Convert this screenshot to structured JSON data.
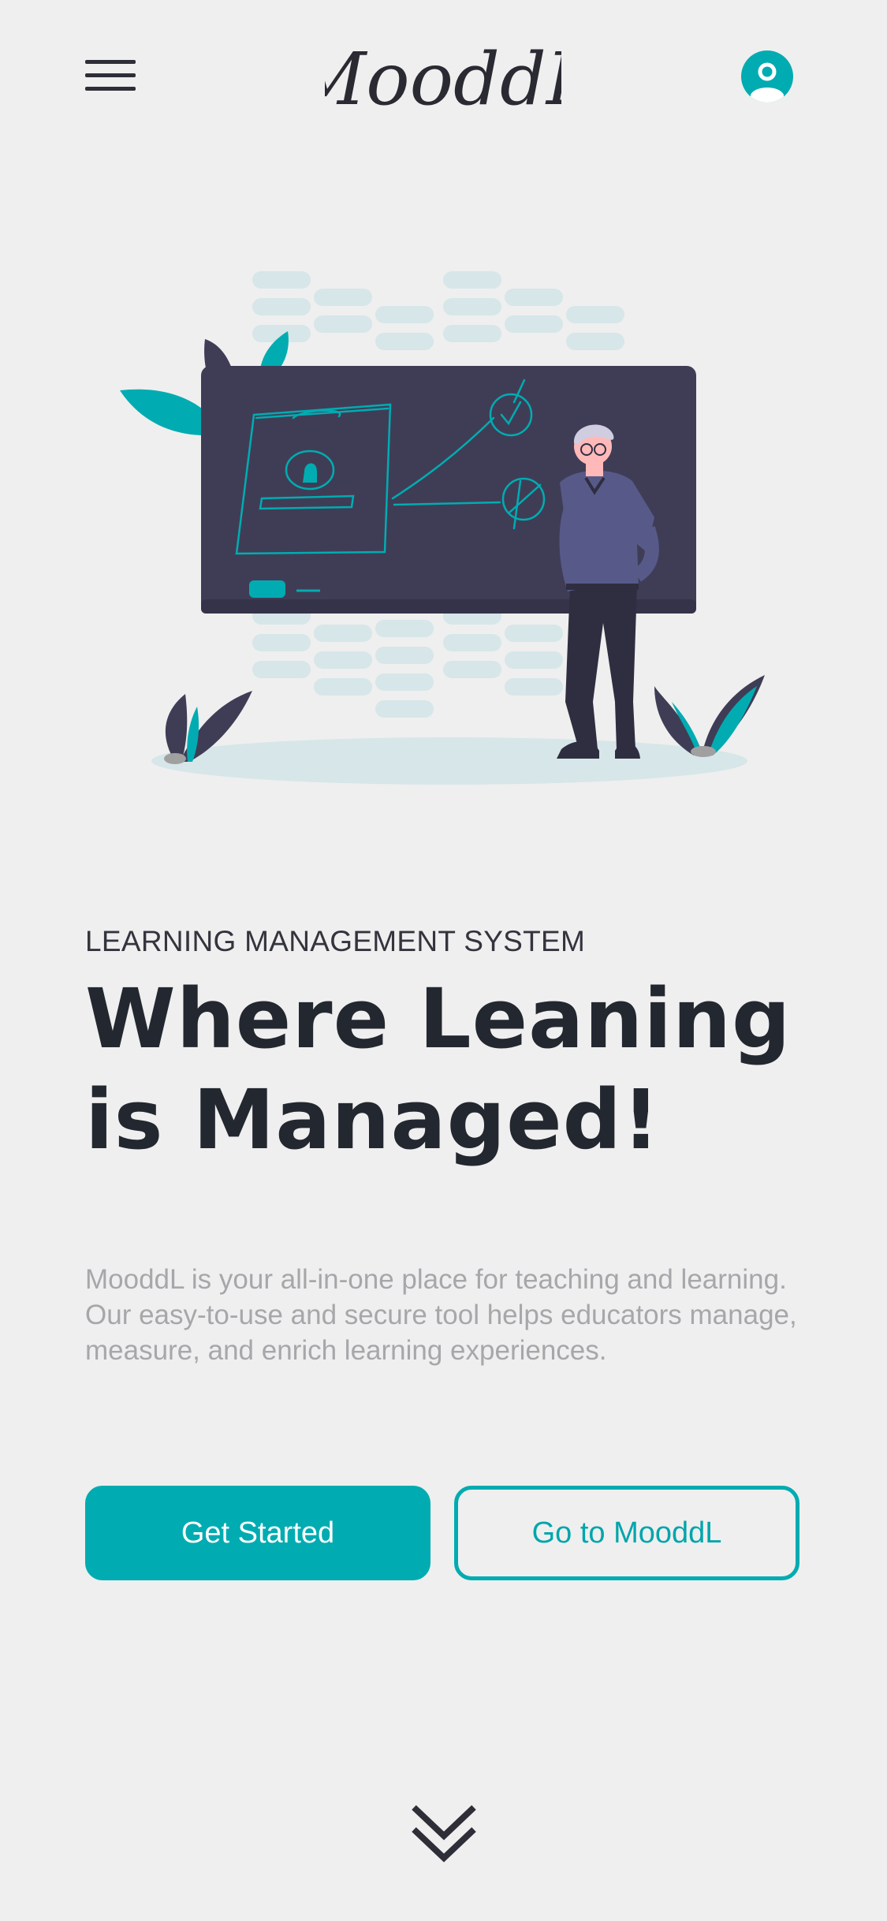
{
  "header": {
    "menu_icon": "hamburger-menu-icon",
    "brand": "MooddL",
    "profile_icon": "user-profile-icon"
  },
  "hero": {
    "illustration": "teacher-at-chalkboard-illustration",
    "eyebrow": "LEARNING MANAGEMENT SYSTEM",
    "headline_line1": "Where Leaning",
    "headline_line2": "is Managed!",
    "description": "MooddL is your all-in-one place for teaching and learning. Our easy-to-use and secure tool helps educators manage, measure, and enrich learning experiences."
  },
  "actions": {
    "primary_label": "Get Started",
    "secondary_label": "Go to MooddL"
  },
  "scroll": {
    "icon": "double-chevron-down-icon"
  },
  "colors": {
    "accent": "#00acb1",
    "background": "#efefef",
    "heading": "#232730",
    "body_text": "#a7a7ab",
    "board": "#3f3d56"
  }
}
